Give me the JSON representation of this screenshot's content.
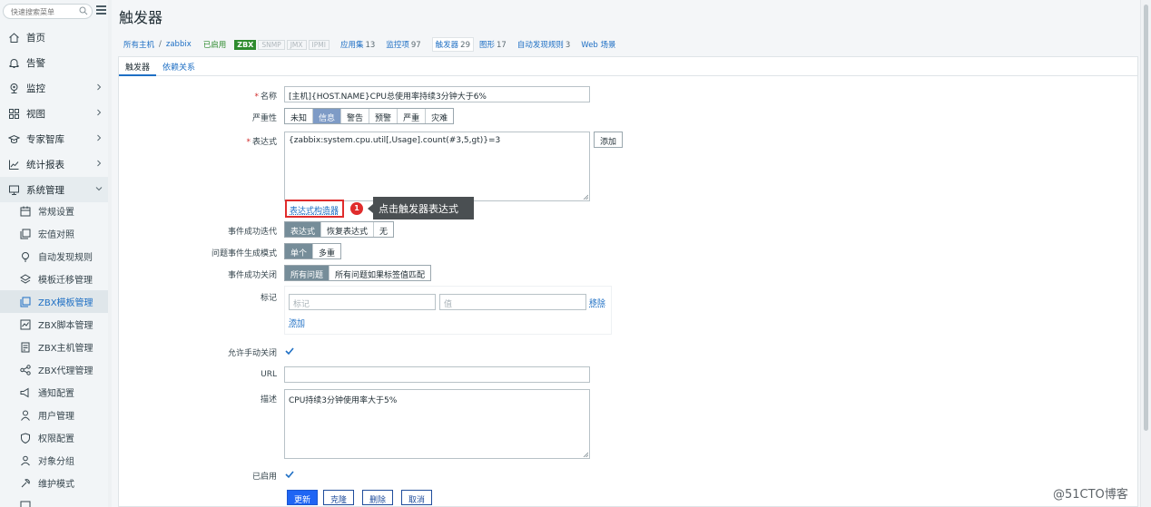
{
  "sidebar": {
    "search_placeholder": "快速搜索菜单",
    "items": [
      {
        "label": "首页",
        "icon": "home-icon"
      },
      {
        "label": "告警",
        "icon": "bell-icon"
      },
      {
        "label": "监控",
        "icon": "monitor-icon"
      },
      {
        "label": "视图",
        "icon": "grid-icon"
      },
      {
        "label": "专家智库",
        "icon": "graduation-cap-icon"
      },
      {
        "label": "统计报表",
        "icon": "line-chart-icon"
      },
      {
        "label": "系统管理",
        "icon": "desktop-icon"
      }
    ],
    "sub_items": [
      {
        "label": "常规设置",
        "icon": "calendar-icon"
      },
      {
        "label": "宏值对照",
        "icon": "copy-icon"
      },
      {
        "label": "自动发现规则",
        "icon": "bulb-icon"
      },
      {
        "label": "模板迁移管理",
        "icon": "layers-icon"
      },
      {
        "label": "ZBX模板管理",
        "icon": "template-icon"
      },
      {
        "label": "ZBX脚本管理",
        "icon": "script-icon"
      },
      {
        "label": "ZBX主机管理",
        "icon": "server-icon"
      },
      {
        "label": "ZBX代理管理",
        "icon": "share-icon"
      },
      {
        "label": "通知配置",
        "icon": "megaphone-icon"
      },
      {
        "label": "用户管理",
        "icon": "user-icon"
      },
      {
        "label": "权限配置",
        "icon": "shield-icon"
      },
      {
        "label": "对象分组",
        "icon": "users-icon"
      },
      {
        "label": "维护模式",
        "icon": "maintenance-icon"
      },
      {
        "label": "",
        "icon": "more-icon"
      }
    ]
  },
  "page": {
    "title": "触发器"
  },
  "breadcrumbs": {
    "all_hosts": "所有主机",
    "sep": "/",
    "host": "zabbix",
    "status": "已启用",
    "zbx": "ZBX",
    "snmp": "SNMP",
    "jmx": "JMX",
    "ipmi": "IPMI",
    "links": [
      {
        "label": "应用集",
        "count": "13"
      },
      {
        "label": "监控项",
        "count": "97"
      },
      {
        "label": "触发器",
        "count": "29"
      },
      {
        "label": "图形",
        "count": "17"
      },
      {
        "label": "自动发现规则",
        "count": "3"
      },
      {
        "label": "Web 场景",
        "count": ""
      }
    ]
  },
  "tabs": [
    "触发器",
    "依赖关系"
  ],
  "form": {
    "name_label": "名称",
    "name_value": "[主机]{HOST.NAME}CPU总使用率持续3分钟大于6%",
    "severity_label": "严重性",
    "severity_options": [
      "未知",
      "信息",
      "警告",
      "预警",
      "严重",
      "灾难"
    ],
    "expression_label": "表达式",
    "expression_value": "{zabbix:system.cpu.util[,Usage].count(#3,5,gt)}=3",
    "add_button": "添加",
    "expr_builder_link": "表达式构造器",
    "event_gen_label": "事件成功迭代",
    "event_gen_options": [
      "表达式",
      "恢复表达式",
      "无"
    ],
    "problem_mode_label": "问题事件生成模式",
    "problem_mode_options": [
      "单个",
      "多重"
    ],
    "ok_close_label": "事件成功关闭",
    "ok_close_options": [
      "所有问题",
      "所有问题如果标签值匹配"
    ],
    "tags_label": "标记",
    "tag_placeholder": "标记",
    "value_placeholder": "值",
    "remove_link": "移除",
    "add_link": "添加",
    "manual_close_label": "允许手动关闭",
    "url_label": "URL",
    "url_value": "",
    "description_label": "描述",
    "description_value": "CPU持续3分钟使用率大于5%",
    "enabled_label": "已启用",
    "buttons": [
      "更新",
      "克隆",
      "删除",
      "取消"
    ]
  },
  "annotation": {
    "step": "1",
    "tooltip": "点击触发器表达式"
  },
  "watermark": "@51CTO博客",
  "colors": {
    "accent": "#1e6fc4",
    "primary_button": "#1f65f4",
    "highlight": "#e02c2c"
  }
}
